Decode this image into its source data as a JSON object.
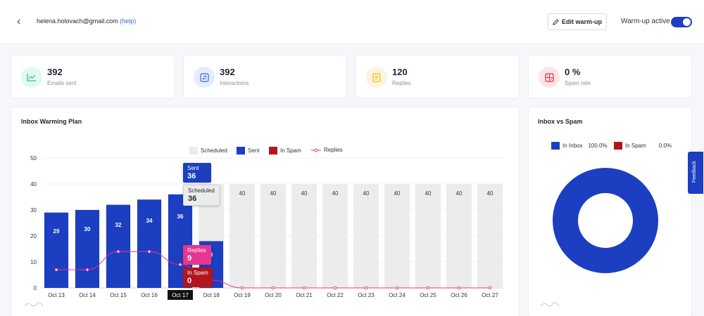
{
  "header": {
    "email": "helena.holovach@gmail.com",
    "help": "(help)",
    "edit_button": "Edit warm-up",
    "warmup_label": "Warm-up active",
    "warmup_on": true
  },
  "stats": [
    {
      "value": "392",
      "label": "Emails sent",
      "icon": "chart-line-icon",
      "color": "#22c39a",
      "bg": "#e3f8f1"
    },
    {
      "value": "392",
      "label": "Interactions",
      "icon": "swap-icon",
      "color": "#2f6ae0",
      "bg": "#e5edfc"
    },
    {
      "value": "120",
      "label": "Replies",
      "icon": "document-icon",
      "color": "#f2b81d",
      "bg": "#fdf5dc"
    },
    {
      "value": "0 %",
      "label": "Spam rate",
      "icon": "spam-icon",
      "color": "#d9353f",
      "bg": "#fbe5e6"
    }
  ],
  "plan": {
    "title": "Inbox Warming Plan",
    "legend": [
      "Scheduled",
      "Sent",
      "In Spam",
      "Replies"
    ],
    "tooltips": {
      "sent_label": "Sent",
      "sent_value": "36",
      "scheduled_label": "Scheduled",
      "scheduled_value": "36",
      "replies_label": "Replies",
      "replies_value": "9",
      "spam_label": "In Spam",
      "spam_value": "0"
    }
  },
  "donut": {
    "title": "Inbox vs Spam",
    "inbox_label": "In Inbox",
    "inbox_value": "100.0%",
    "spam_label": "In Spam",
    "spam_value": "0.0%"
  },
  "feedback": "Feedback",
  "colors": {
    "sent": "#1b3fc0",
    "spam": "#b3151e",
    "scheduled": "#ececec",
    "replies": "#e8358f"
  },
  "chart_data": {
    "type": "bar",
    "categories": [
      "Oct 13",
      "Oct 14",
      "Oct 15",
      "Oct 16",
      "Oct 17",
      "Oct 18",
      "Oct 19",
      "Oct 20",
      "Oct 21",
      "Oct 22",
      "Oct 23",
      "Oct 24",
      "Oct 25",
      "Oct 26",
      "Oct 27"
    ],
    "series": [
      {
        "name": "Scheduled",
        "values": [
          29,
          30,
          32,
          34,
          36,
          40,
          40,
          40,
          40,
          40,
          40,
          40,
          40,
          40,
          40
        ]
      },
      {
        "name": "Sent",
        "values": [
          29,
          30,
          32,
          34,
          36,
          18,
          0,
          0,
          0,
          0,
          0,
          0,
          0,
          0,
          0
        ]
      },
      {
        "name": "In Spam",
        "values": [
          0,
          0,
          0,
          0,
          0,
          0,
          0,
          0,
          0,
          0,
          0,
          0,
          0,
          0,
          0
        ]
      },
      {
        "name": "Replies",
        "values": [
          7,
          7,
          14,
          14,
          9,
          3,
          0,
          0,
          0,
          0,
          0,
          0,
          0,
          0,
          0
        ]
      }
    ],
    "bar_labels": [
      "29",
      "30",
      "32",
      "34",
      "36",
      "8",
      "40",
      "40",
      "40",
      "40",
      "40",
      "40",
      "40",
      "40",
      "40"
    ],
    "yticks": [
      0,
      10,
      20,
      30,
      40,
      50
    ],
    "ylim": [
      0,
      50
    ],
    "active_category": "Oct 17",
    "donut": {
      "type": "pie",
      "labels": [
        "In Inbox",
        "In Spam"
      ],
      "values": [
        100.0,
        0.0
      ]
    }
  }
}
